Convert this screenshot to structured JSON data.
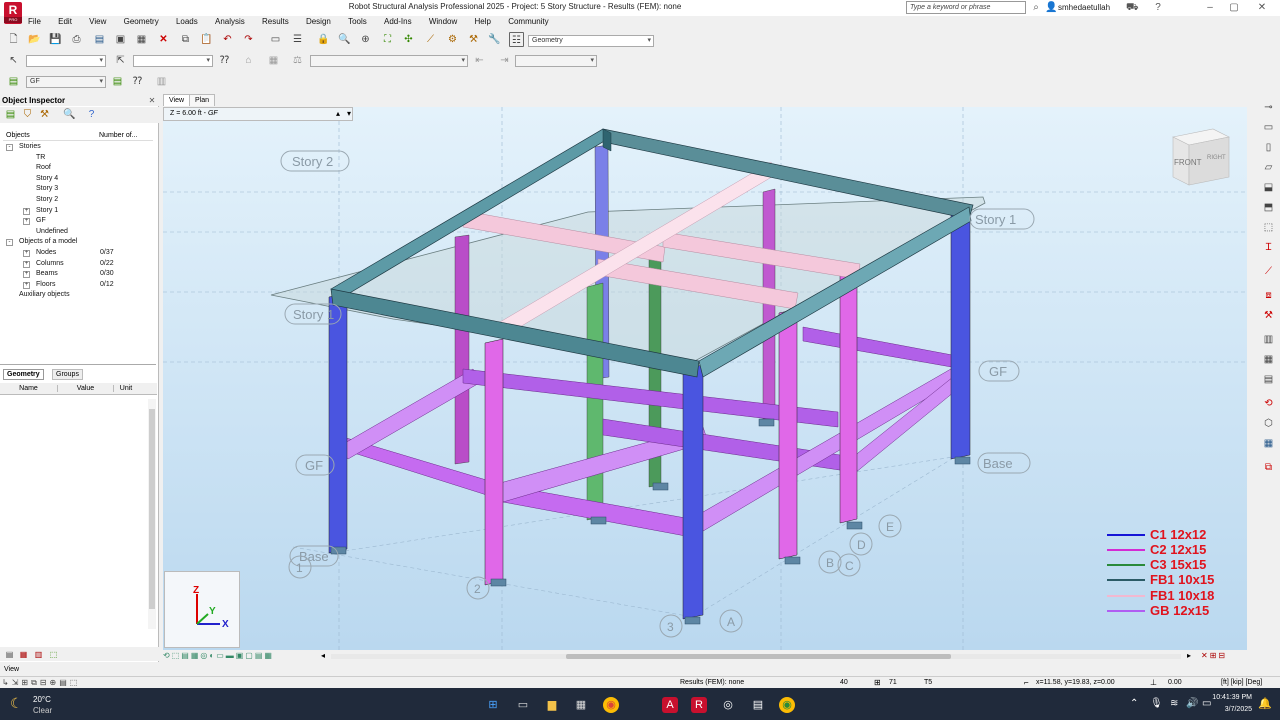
{
  "window": {
    "title": "Robot Structural Analysis Professional 2025 - Project: 5 Story Structure - Results (FEM): none",
    "search_placeholder": "Type a keyword or phrase",
    "user": "smhedaetullah",
    "logo": "R",
    "logo_sub": "PRO"
  },
  "menu": [
    "File",
    "Edit",
    "View",
    "Geometry",
    "Loads",
    "Analysis",
    "Results",
    "Design",
    "Tools",
    "Add-Ins",
    "Window",
    "Help",
    "Community"
  ],
  "toolbar": {
    "layout_select": "Geometry",
    "story_select": "GF"
  },
  "inspector": {
    "title": "Object Inspector",
    "col_objects": "Objects",
    "col_number": "Number of...",
    "tree": [
      {
        "label": "Stories",
        "indent": 1,
        "expand": "-"
      },
      {
        "label": "TR",
        "indent": 2
      },
      {
        "label": "Roof",
        "indent": 2
      },
      {
        "label": "Story 4",
        "indent": 2
      },
      {
        "label": "Story 3",
        "indent": 2
      },
      {
        "label": "Story 2",
        "indent": 2
      },
      {
        "label": "Story 1",
        "indent": 2,
        "expand": "+"
      },
      {
        "label": "GF",
        "indent": 2,
        "expand": "+"
      },
      {
        "label": "Undefined",
        "indent": 2
      },
      {
        "label": "Objects of a model",
        "indent": 1,
        "expand": "-"
      },
      {
        "label": "Nodes",
        "indent": 2,
        "expand": "+",
        "count": "0/37"
      },
      {
        "label": "Columns",
        "indent": 2,
        "expand": "+",
        "count": "0/22"
      },
      {
        "label": "Beams",
        "indent": 2,
        "expand": "+",
        "count": "0/30"
      },
      {
        "label": "Floors",
        "indent": 2,
        "expand": "+",
        "count": "0/12"
      },
      {
        "label": "Auxiliary objects",
        "indent": 1
      }
    ],
    "tabs": [
      "Geometry",
      "Groups"
    ],
    "prop_headers": [
      "Name",
      "Value",
      "Unit"
    ]
  },
  "view": {
    "tabs": [
      "View",
      "Plan"
    ],
    "z_label": "Z = 6.00 ft - ",
    "z_story": "GF",
    "cube_front": "FRONT",
    "cube_right": "RIGHT",
    "story_labels": [
      "Story 2",
      "Story 1",
      "Story 1",
      "GF",
      "GF",
      "Base",
      "Base"
    ],
    "grid_labels": [
      "1",
      "2",
      "3",
      "A",
      "B",
      "C",
      "D",
      "E"
    ],
    "axes": {
      "x": "X",
      "y": "Y",
      "z": "Z"
    }
  },
  "legend": [
    {
      "label": "C1 12x12",
      "color": "#1515d6"
    },
    {
      "label": "C2 12x15",
      "color": "#d42bd4"
    },
    {
      "label": "C3 15x15",
      "color": "#2a8a3a"
    },
    {
      "label": "FB1 10x15",
      "color": "#2b5b66"
    },
    {
      "label": "FB1 10x18",
      "color": "#f2b8d0"
    },
    {
      "label": "GB 12x15",
      "color": "#b05ef2"
    }
  ],
  "status": {
    "left": "View",
    "results": "Results (FEM): none",
    "n1": "40",
    "n2": "71",
    "n3": "T5",
    "coords": "x=11.58, y=19.83, z=0.00",
    "value": "0.00",
    "units": "[ft] [kip] [Deg]"
  },
  "taskbar": {
    "temp": "20°C",
    "weather": "Clear",
    "time": "10:41:39 PM",
    "date": "3/7/2025"
  }
}
